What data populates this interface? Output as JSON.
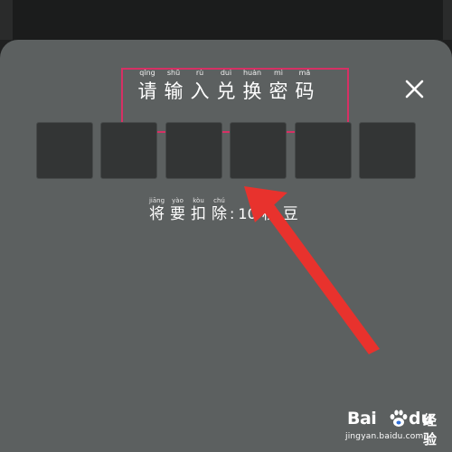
{
  "dialog": {
    "title_chars": [
      {
        "pinyin": "qǐng",
        "char": "请"
      },
      {
        "pinyin": "shū",
        "char": "输"
      },
      {
        "pinyin": "rù",
        "char": "入"
      },
      {
        "pinyin": "duì",
        "char": "兑"
      },
      {
        "pinyin": "huàn",
        "char": "换"
      },
      {
        "pinyin": "mì",
        "char": "密"
      },
      {
        "pinyin": "mǎ",
        "char": "码"
      }
    ],
    "close_icon": "close-icon",
    "code_box_count": 6,
    "deduct": {
      "chars": [
        {
          "pinyin": "jiāng",
          "char": "将"
        },
        {
          "pinyin": "yào",
          "char": "要"
        },
        {
          "pinyin": "kòu",
          "char": "扣"
        },
        {
          "pinyin": "chú",
          "char": "除"
        }
      ],
      "colon": ":",
      "amount": "10",
      "unit_chars": [
        {
          "pinyin": "",
          "char": "秘"
        },
        {
          "pinyin": "",
          "char": "豆"
        }
      ]
    }
  },
  "annotation": {
    "highlight_color": "#d63064",
    "arrow_color": "#e8322d"
  },
  "watermark": {
    "brand_left": "Bai",
    "brand_paw": "paw-icon",
    "brand_right": "du",
    "brand_cn": "经验",
    "url": "jingyan.baidu.com"
  },
  "colors": {
    "background": "#1f2020",
    "dialog": "#5c6060",
    "code_box": "#333535",
    "text": "#ffffff"
  }
}
